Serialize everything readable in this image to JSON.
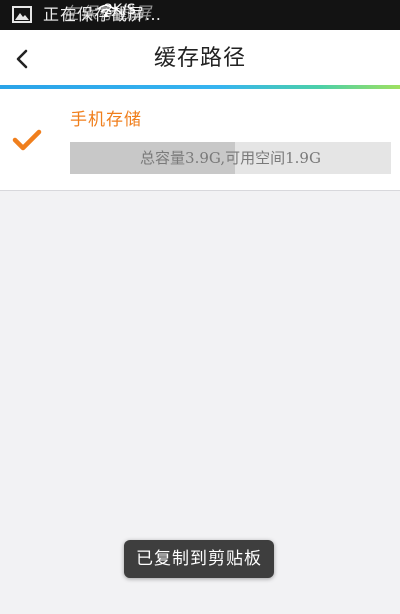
{
  "status_bar": {
    "notification_text": "正在保存截屏…",
    "overlay_text": "在保存截屏",
    "network_speed": "2K/S",
    "icons": [
      "gallery-icon",
      "wifi-icon"
    ]
  },
  "header": {
    "title": "缓存路径",
    "back_icon": "chevron-left-icon"
  },
  "storage": {
    "name": "手机存储",
    "capacity_text": "总容量3.9G,可用空间1.9G",
    "total_gb": 3.9,
    "available_gb": 1.9,
    "selected": true
  },
  "toast": {
    "message": "已复制到剪贴板"
  },
  "colors": {
    "accent_orange": "#f07f1d",
    "header_line_blue": "#2aa3e8",
    "status_bar_bg": "#131313",
    "page_bg": "#f2f2f4"
  }
}
